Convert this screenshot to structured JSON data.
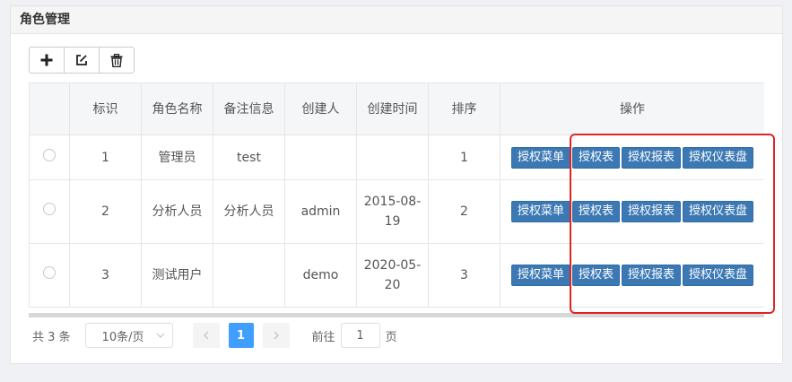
{
  "panel": {
    "title": "角色管理"
  },
  "toolbar": {
    "buttons": [
      {
        "icon": "plus-icon"
      },
      {
        "icon": "edit-icon"
      },
      {
        "icon": "trash-icon"
      }
    ]
  },
  "table": {
    "columns": [
      "",
      "标识",
      "角色名称",
      "备注信息",
      "创建人",
      "创建时间",
      "排序",
      "操作"
    ],
    "rows": [
      {
        "id": "1",
        "name": "管理员",
        "remark": "test",
        "creator": "",
        "created": "",
        "sort": "1"
      },
      {
        "id": "2",
        "name": "分析人员",
        "remark": "分析人员",
        "creator": "admin",
        "created": "2015-08-19",
        "sort": "2"
      },
      {
        "id": "3",
        "name": "测试用户",
        "remark": "",
        "creator": "demo",
        "created": "2020-05-20",
        "sort": "3"
      }
    ],
    "actions": [
      "授权菜单",
      "授权表",
      "授权报表",
      "授权仪表盘"
    ]
  },
  "pagination": {
    "total": "共 3 条",
    "page_size": "10条/页",
    "current_page": "1",
    "goto_label": "前往",
    "goto_value": "1",
    "page_suffix": "页"
  },
  "colors": {
    "action_button": "#3c79b4",
    "pager_active": "#409eff",
    "highlight": "#e02424"
  }
}
